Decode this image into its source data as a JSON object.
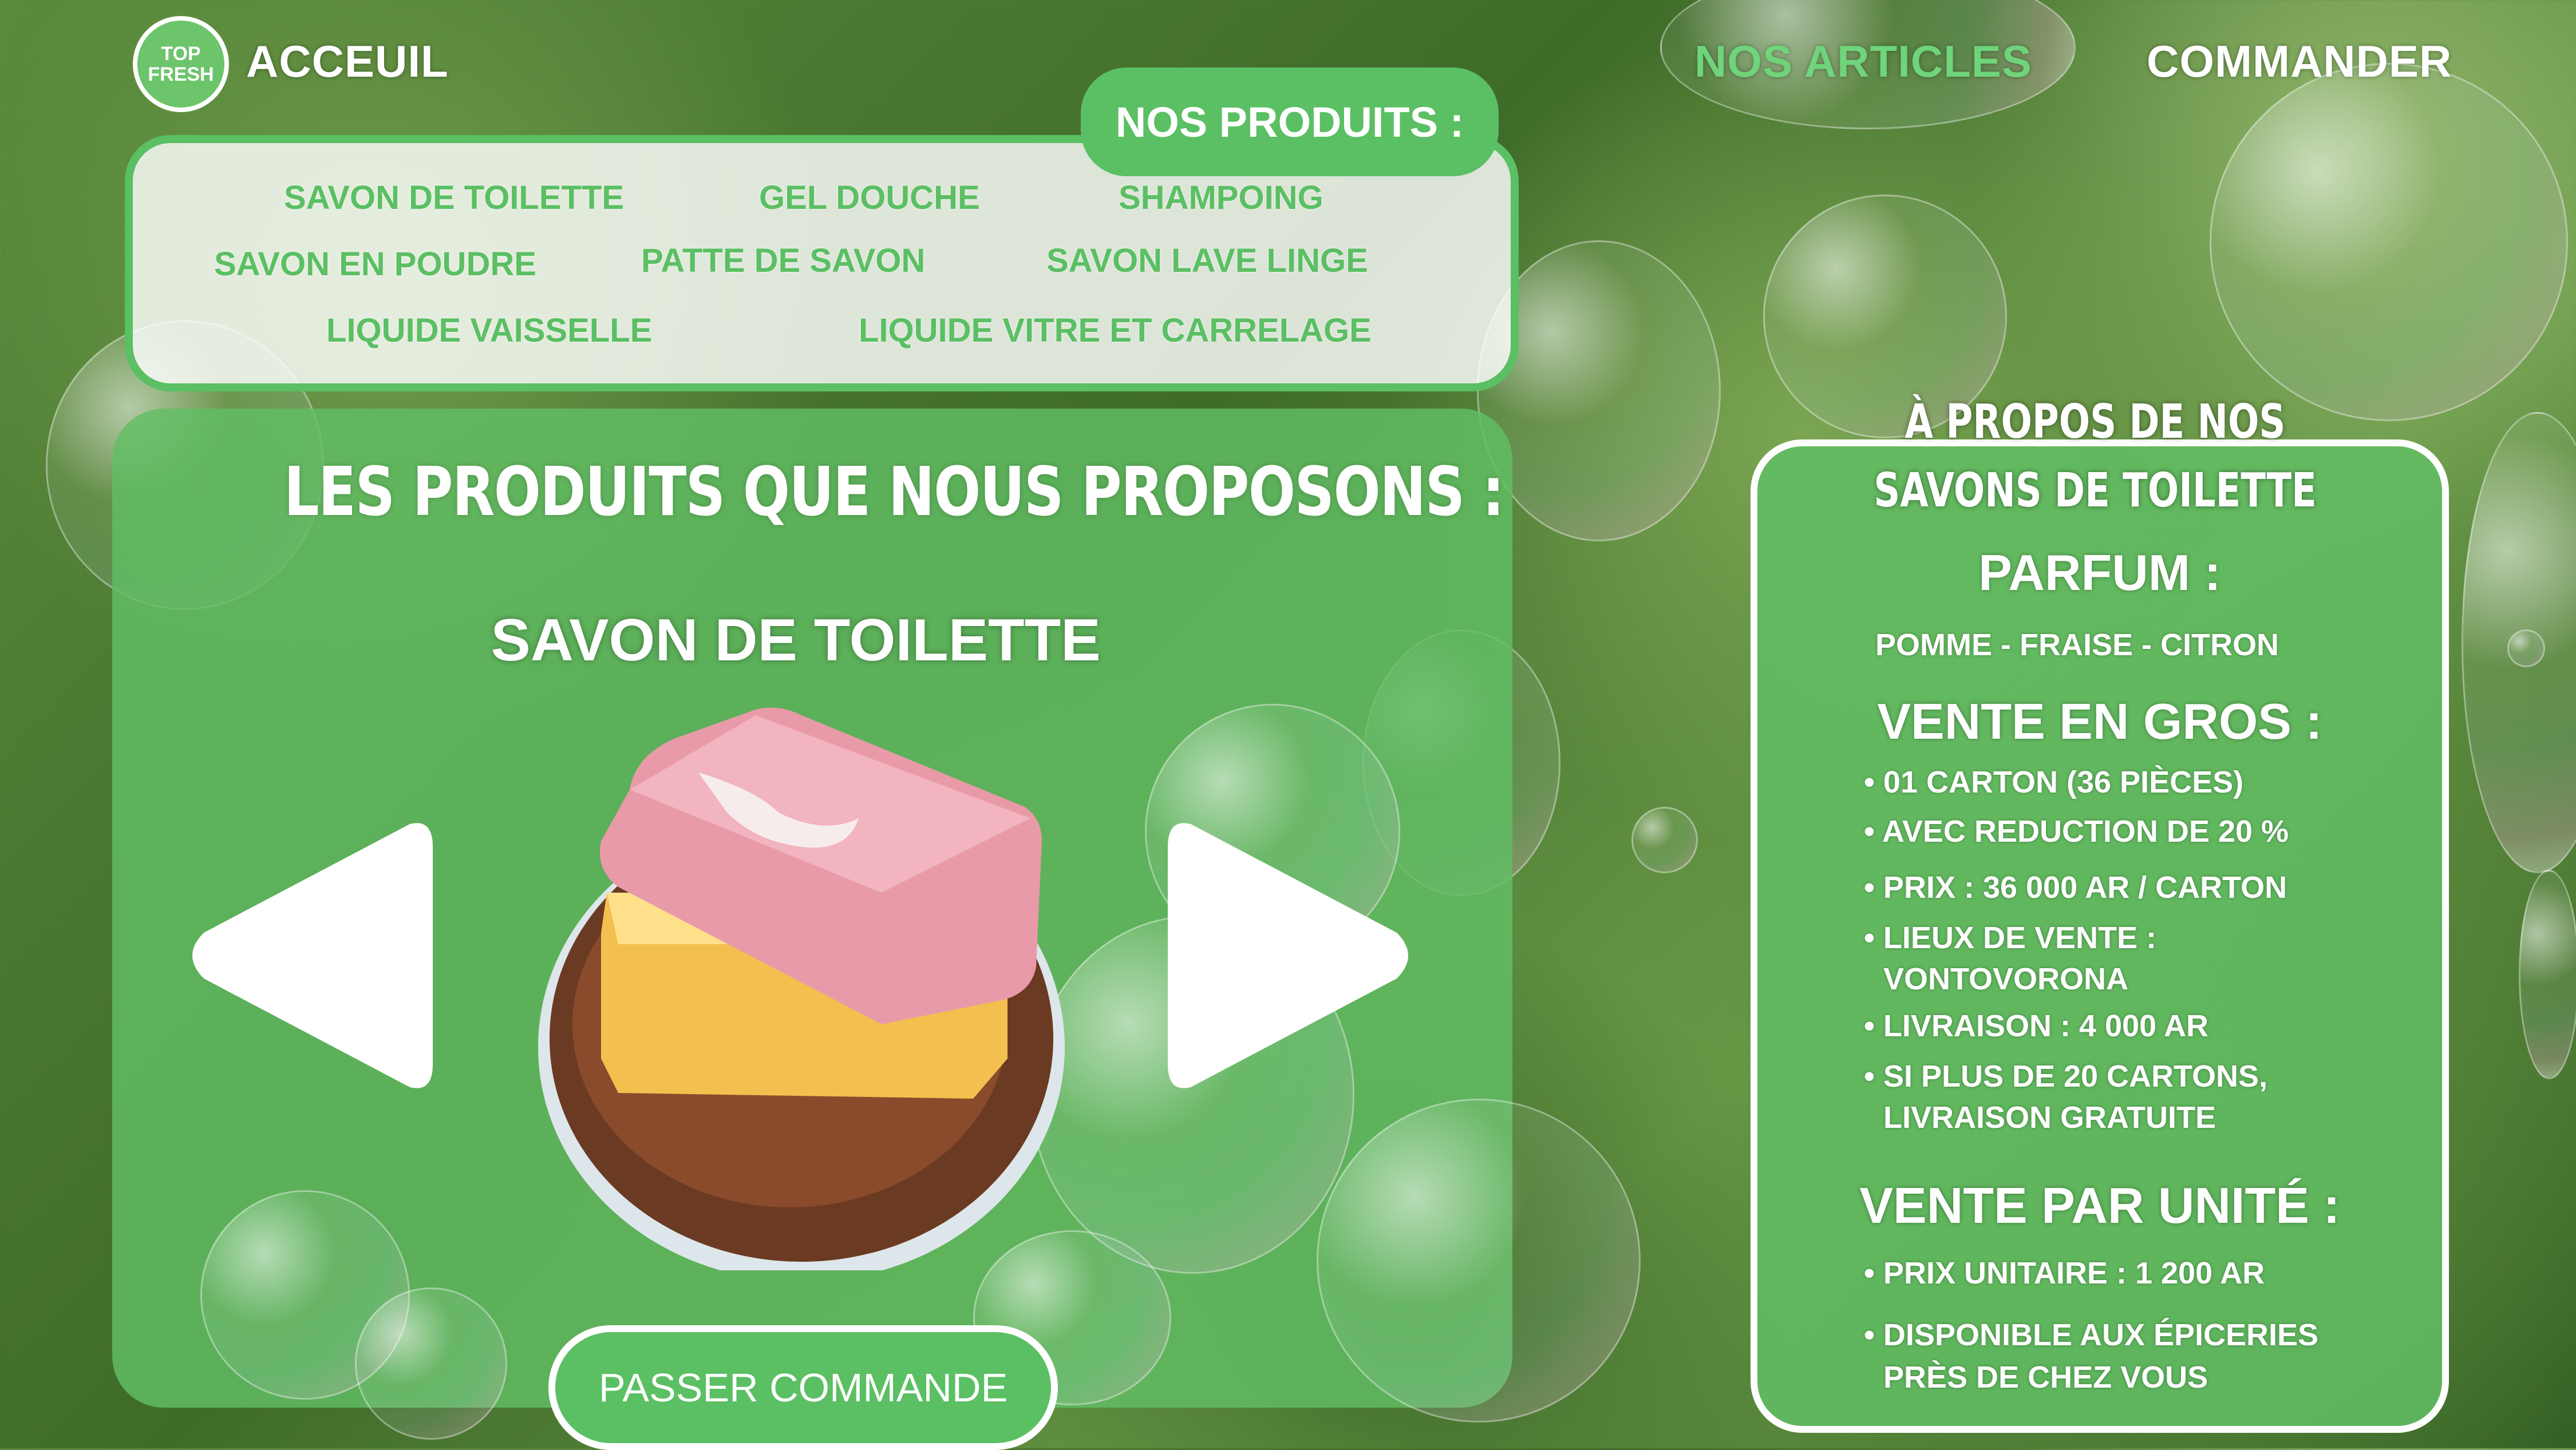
{
  "nav": {
    "logo_text_top": "TOP",
    "logo_text_bottom": "FRESH",
    "home": "ACCEUIL",
    "articles": "NOS ARTICLES",
    "order": "COMMANDER"
  },
  "products_menu": {
    "title": "NOS PRODUITS :",
    "items": [
      "SAVON DE TOILETTE",
      "GEL DOUCHE",
      "SHAMPOING",
      "SAVON EN POUDRE",
      "PATTE DE SAVON",
      "SAVON LAVE LINGE",
      "LIQUIDE VAISSELLE",
      "LIQUIDE VITRE ET CARRELAGE"
    ]
  },
  "main": {
    "title": "LES PRODUITS QUE NOUS PROPOSONS :",
    "product_name": "SAVON DE TOILETTE",
    "order_button": "PASSER COMMANDE"
  },
  "info": {
    "title_line1": "À PROPOS DE NOS",
    "title_line2": "SAVONS DE TOILETTE",
    "parfum_head": "PARFUM :",
    "parfum_value": "POMME - FRAISE - CITRON",
    "gros_head": "VENTE EN GROS :",
    "gros_items": [
      "01 CARTON (36 PIÈCES)",
      "AVEC REDUCTION DE 20 %",
      "PRIX : 36 000 AR / CARTON",
      "LIEUX DE VENTE :",
      "VONTOVORONA",
      "LIVRAISON : 4 000 AR",
      "SI PLUS DE 20 CARTONS,",
      "LIVRAISON GRATUITE"
    ],
    "unite_head": "VENTE PAR UNITÉ :",
    "unite_items": [
      "PRIX UNITAIRE : 1 200 AR",
      "DISPONIBLE AUX ÉPICERIES",
      "PRÈS DE CHEZ VOUS"
    ]
  },
  "colors": {
    "brand_green": "#5bbf63",
    "active_link": "#6fd47a",
    "white": "#ffffff"
  }
}
